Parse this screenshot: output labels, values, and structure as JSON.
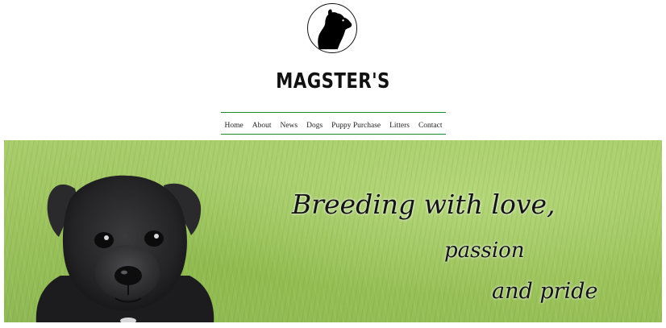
{
  "brand": {
    "name": "MAGSTER'S",
    "logo_icon": "dog-silhouette-icon"
  },
  "nav": {
    "items": [
      {
        "label": "Home"
      },
      {
        "label": "About"
      },
      {
        "label": "News"
      },
      {
        "label": "Dogs"
      },
      {
        "label": "Puppy Purchase"
      },
      {
        "label": "Litters"
      },
      {
        "label": "Contact"
      }
    ],
    "rule_color": "#1f8a2c"
  },
  "hero": {
    "line1": "Breeding with love,",
    "line2": "passion",
    "line3": "and pride",
    "background_color": "#9ec460"
  }
}
